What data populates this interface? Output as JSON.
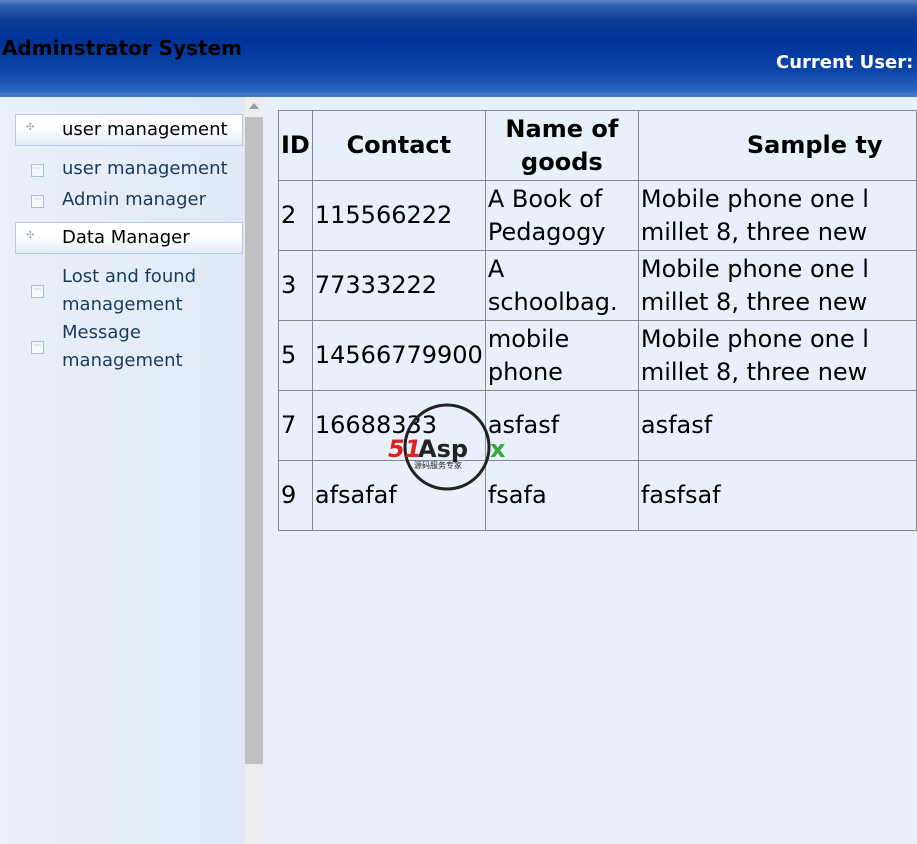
{
  "header": {
    "title": "Adminstrator System",
    "current_user_label": "Current User:"
  },
  "sidebar": {
    "groups": [
      {
        "label": "user management",
        "items": [
          "user management",
          "Admin manager"
        ]
      },
      {
        "label": "Data Manager",
        "items": [
          "Lost and found management",
          "Message management"
        ]
      }
    ]
  },
  "table": {
    "headers": [
      "ID",
      "Contact",
      "Name of goods",
      "Sample ty"
    ],
    "rows": [
      [
        "2",
        "115566222",
        "A Book of Pedagogy",
        "Mobile phone one l millet 8, three new"
      ],
      [
        "3",
        "77333222",
        "A schoolbag.",
        "Mobile phone one l millet 8, three new"
      ],
      [
        "5",
        "14566779900",
        "mobile phone",
        "Mobile phone one l millet 8, three new"
      ],
      [
        "7",
        "16688333",
        "asfasf",
        "asfasf"
      ],
      [
        "9",
        "afsafaf",
        "fsafa",
        "fasfsaf"
      ]
    ]
  },
  "watermark": {
    "brand": "51Aspx",
    "tagline": "源码服务专家"
  }
}
